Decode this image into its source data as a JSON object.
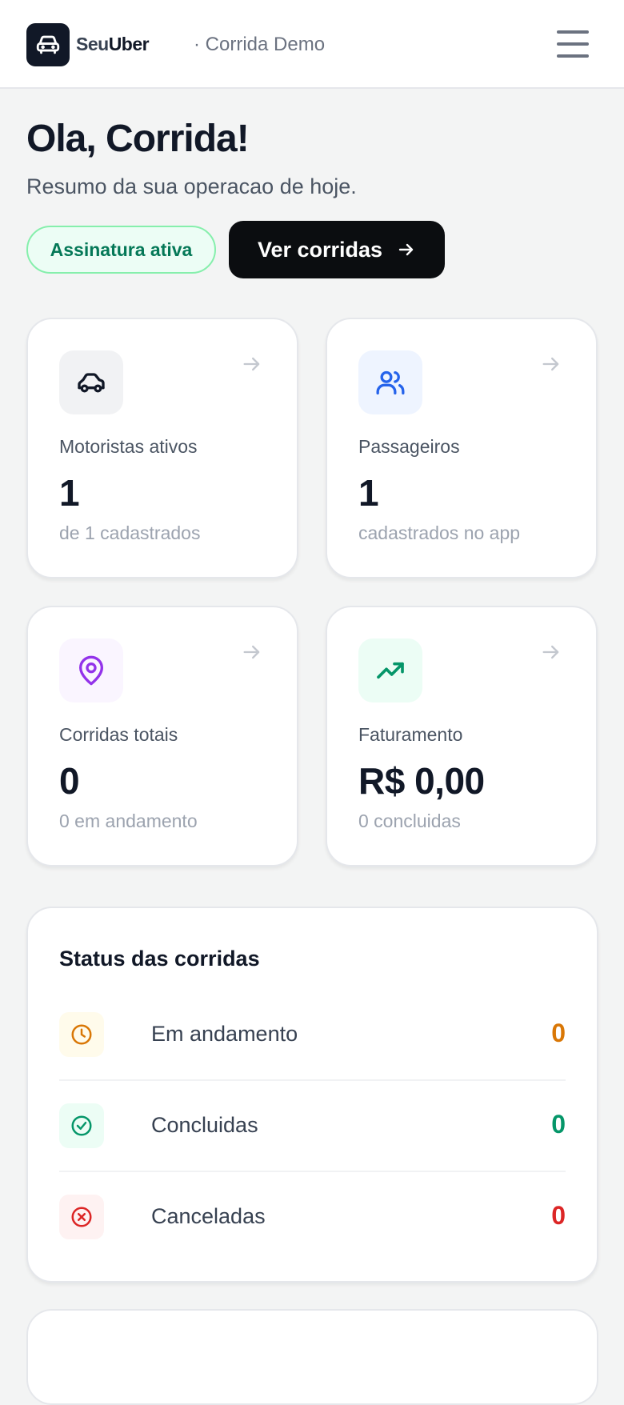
{
  "header": {
    "brand_prefix": "Seu",
    "brand_suffix": "Uber",
    "tenant": "· Corrida Demo",
    "menu_icon": "hamburger-menu-icon"
  },
  "hero": {
    "greeting": "Ola, Corrida!",
    "subtitle": "Resumo da sua operacao de hoje.",
    "badge": "Assinatura ativa",
    "cta": "Ver corridas"
  },
  "cards": [
    {
      "icon": "car-icon",
      "label": "Motoristas ativos",
      "value": "1",
      "sub": "de 1 cadastrados",
      "icon_bg": "#f1f2f4",
      "icon_color": "#111827"
    },
    {
      "icon": "users-icon",
      "label": "Passageiros",
      "value": "1",
      "sub": "cadastrados no app",
      "icon_bg": "#eef4ff",
      "icon_color": "#2563eb"
    },
    {
      "icon": "map-pin-icon",
      "label": "Corridas totais",
      "value": "0",
      "sub": "0 em andamento",
      "icon_bg": "#faf5ff",
      "icon_color": "#9333ea"
    },
    {
      "icon": "trending-up-icon",
      "label": "Faturamento",
      "value": "R$ 0,00",
      "sub": "0 concluidas",
      "icon_bg": "#ecfdf5",
      "icon_color": "#059669"
    }
  ],
  "status": {
    "title": "Status das corridas",
    "rows": [
      {
        "icon": "clock-icon",
        "label": "Em andamento",
        "count": "0",
        "color": "#d97706",
        "bg": "#fffbeb"
      },
      {
        "icon": "check-circle-icon",
        "label": "Concluidas",
        "count": "0",
        "color": "#059669",
        "bg": "#ecfdf5"
      },
      {
        "icon": "x-circle-icon",
        "label": "Canceladas",
        "count": "0",
        "color": "#dc2626",
        "bg": "#fef2f2"
      }
    ]
  }
}
